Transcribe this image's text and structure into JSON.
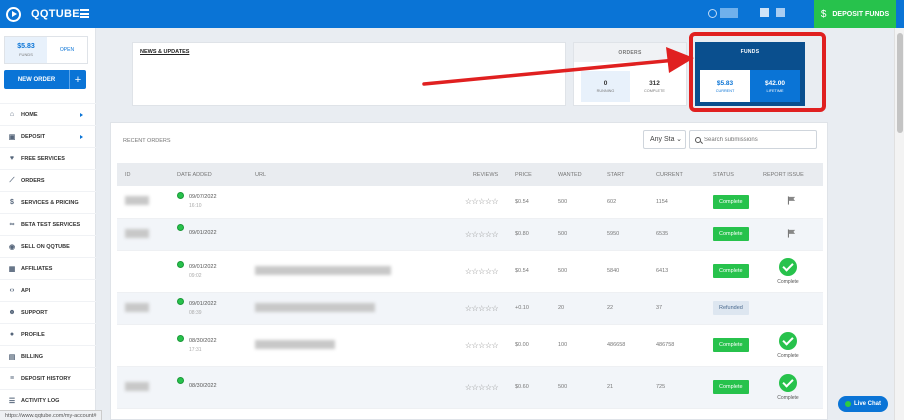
{
  "topbar": {
    "brand": "QQTUBE",
    "deposit_button": "DEPOSIT FUNDS",
    "dollar_icon": "$"
  },
  "sidebar": {
    "funds_amount": "$5.83",
    "funds_label": "FUNDS",
    "open_label": "OPEN",
    "new_order_label": "NEW ORDER",
    "new_order_plus": "+",
    "items": [
      {
        "label": "HOME",
        "icon": "home-icon",
        "chevron": true
      },
      {
        "label": "DEPOSIT",
        "icon": "briefcase-icon",
        "chevron": true
      },
      {
        "label": "FREE SERVICES",
        "icon": "heart-icon",
        "chevron": false
      },
      {
        "label": "ORDERS",
        "icon": "chart-icon",
        "chevron": false
      },
      {
        "label": "SERVICES & PRICING",
        "icon": "dollar-icon",
        "chevron": false
      },
      {
        "label": "BETA TEST SERVICES",
        "icon": "link-icon",
        "chevron": false
      },
      {
        "label": "SELL ON QQTUBE",
        "icon": "circle-dot-icon",
        "chevron": false
      },
      {
        "label": "AFFILIATES",
        "icon": "grid-icon",
        "chevron": false
      },
      {
        "label": "API",
        "icon": "code-icon",
        "chevron": false
      },
      {
        "label": "SUPPORT",
        "icon": "users-icon",
        "chevron": false
      },
      {
        "label": "PROFILE",
        "icon": "user-icon",
        "chevron": false
      },
      {
        "label": "BILLING",
        "icon": "document-icon",
        "chevron": false
      },
      {
        "label": "DEPOSIT HISTORY",
        "icon": "history-icon",
        "chevron": false
      },
      {
        "label": "ACTIVITY LOG",
        "icon": "list-icon",
        "chevron": false
      }
    ]
  },
  "news": {
    "title": "NEWS & UPDATES"
  },
  "orders_card": {
    "title": "ORDERS",
    "running_value": "0",
    "running_label": "RUNNING",
    "complete_value": "312",
    "complete_label": "COMPLETE"
  },
  "funds_card": {
    "title": "FUNDS",
    "current_value": "$5.83",
    "current_label": "CURRENT",
    "lifetime_value": "$42.00",
    "lifetime_label": "LIFETIME"
  },
  "recent_orders": {
    "title": "RECENT ORDERS",
    "filter_value": "Any Sta",
    "search_placeholder": "Search submissions",
    "columns": [
      "ID",
      "DATE ADDED",
      "URL",
      "REVIEWS",
      "PRICE",
      "WANTED",
      "START",
      "CURRENT",
      "STATUS",
      "REPORT ISSUE"
    ],
    "rows": [
      {
        "date": "09/07/2022",
        "time": "16:10",
        "reviews": "☆☆☆☆☆",
        "price": "$0.54",
        "wanted": "500",
        "start": "602",
        "current": "1154",
        "status": "Complete",
        "status_type": "button",
        "report": "flag",
        "report_label": ""
      },
      {
        "date": "09/01/2022",
        "time": "",
        "reviews": "☆☆☆☆☆",
        "price": "$0.80",
        "wanted": "500",
        "start": "5950",
        "current": "6535",
        "status": "Complete",
        "status_type": "button",
        "report": "flag",
        "report_label": ""
      },
      {
        "date": "09/01/2022",
        "time": "09:02",
        "reviews": "☆☆☆☆☆",
        "price": "$0.54",
        "wanted": "500",
        "start": "5840",
        "current": "6413",
        "status": "Complete",
        "status_type": "button",
        "report": "check",
        "report_label": "Complete"
      },
      {
        "date": "09/01/2022",
        "time": "08:39",
        "reviews": "☆☆☆☆☆",
        "price": "+0.10",
        "wanted": "20",
        "start": "22",
        "current": "37",
        "status": "Refunded",
        "status_type": "refunded",
        "report": "none",
        "report_label": ""
      },
      {
        "date": "08/30/2022",
        "time": "17:31",
        "reviews": "☆☆☆☆☆",
        "price": "$0.00",
        "wanted": "100",
        "start": "486658",
        "current": "486758",
        "status": "Complete",
        "status_type": "button",
        "report": "check",
        "report_label": "Complete"
      },
      {
        "date": "08/30/2022",
        "time": "",
        "reviews": "☆☆☆☆☆",
        "price": "$0.60",
        "wanted": "500",
        "start": "21",
        "current": "725",
        "status": "Complete",
        "status_type": "button",
        "report": "check",
        "report_label": "Complete"
      }
    ]
  },
  "status_bar_url": "https://www.qqtube.com/my-account#",
  "live_chat": "Live Chat",
  "colors": {
    "brand_blue": "#0a74d6",
    "green": "#27c24c",
    "highlight_red": "#e02020",
    "funds_dark": "#0a4f8e"
  }
}
